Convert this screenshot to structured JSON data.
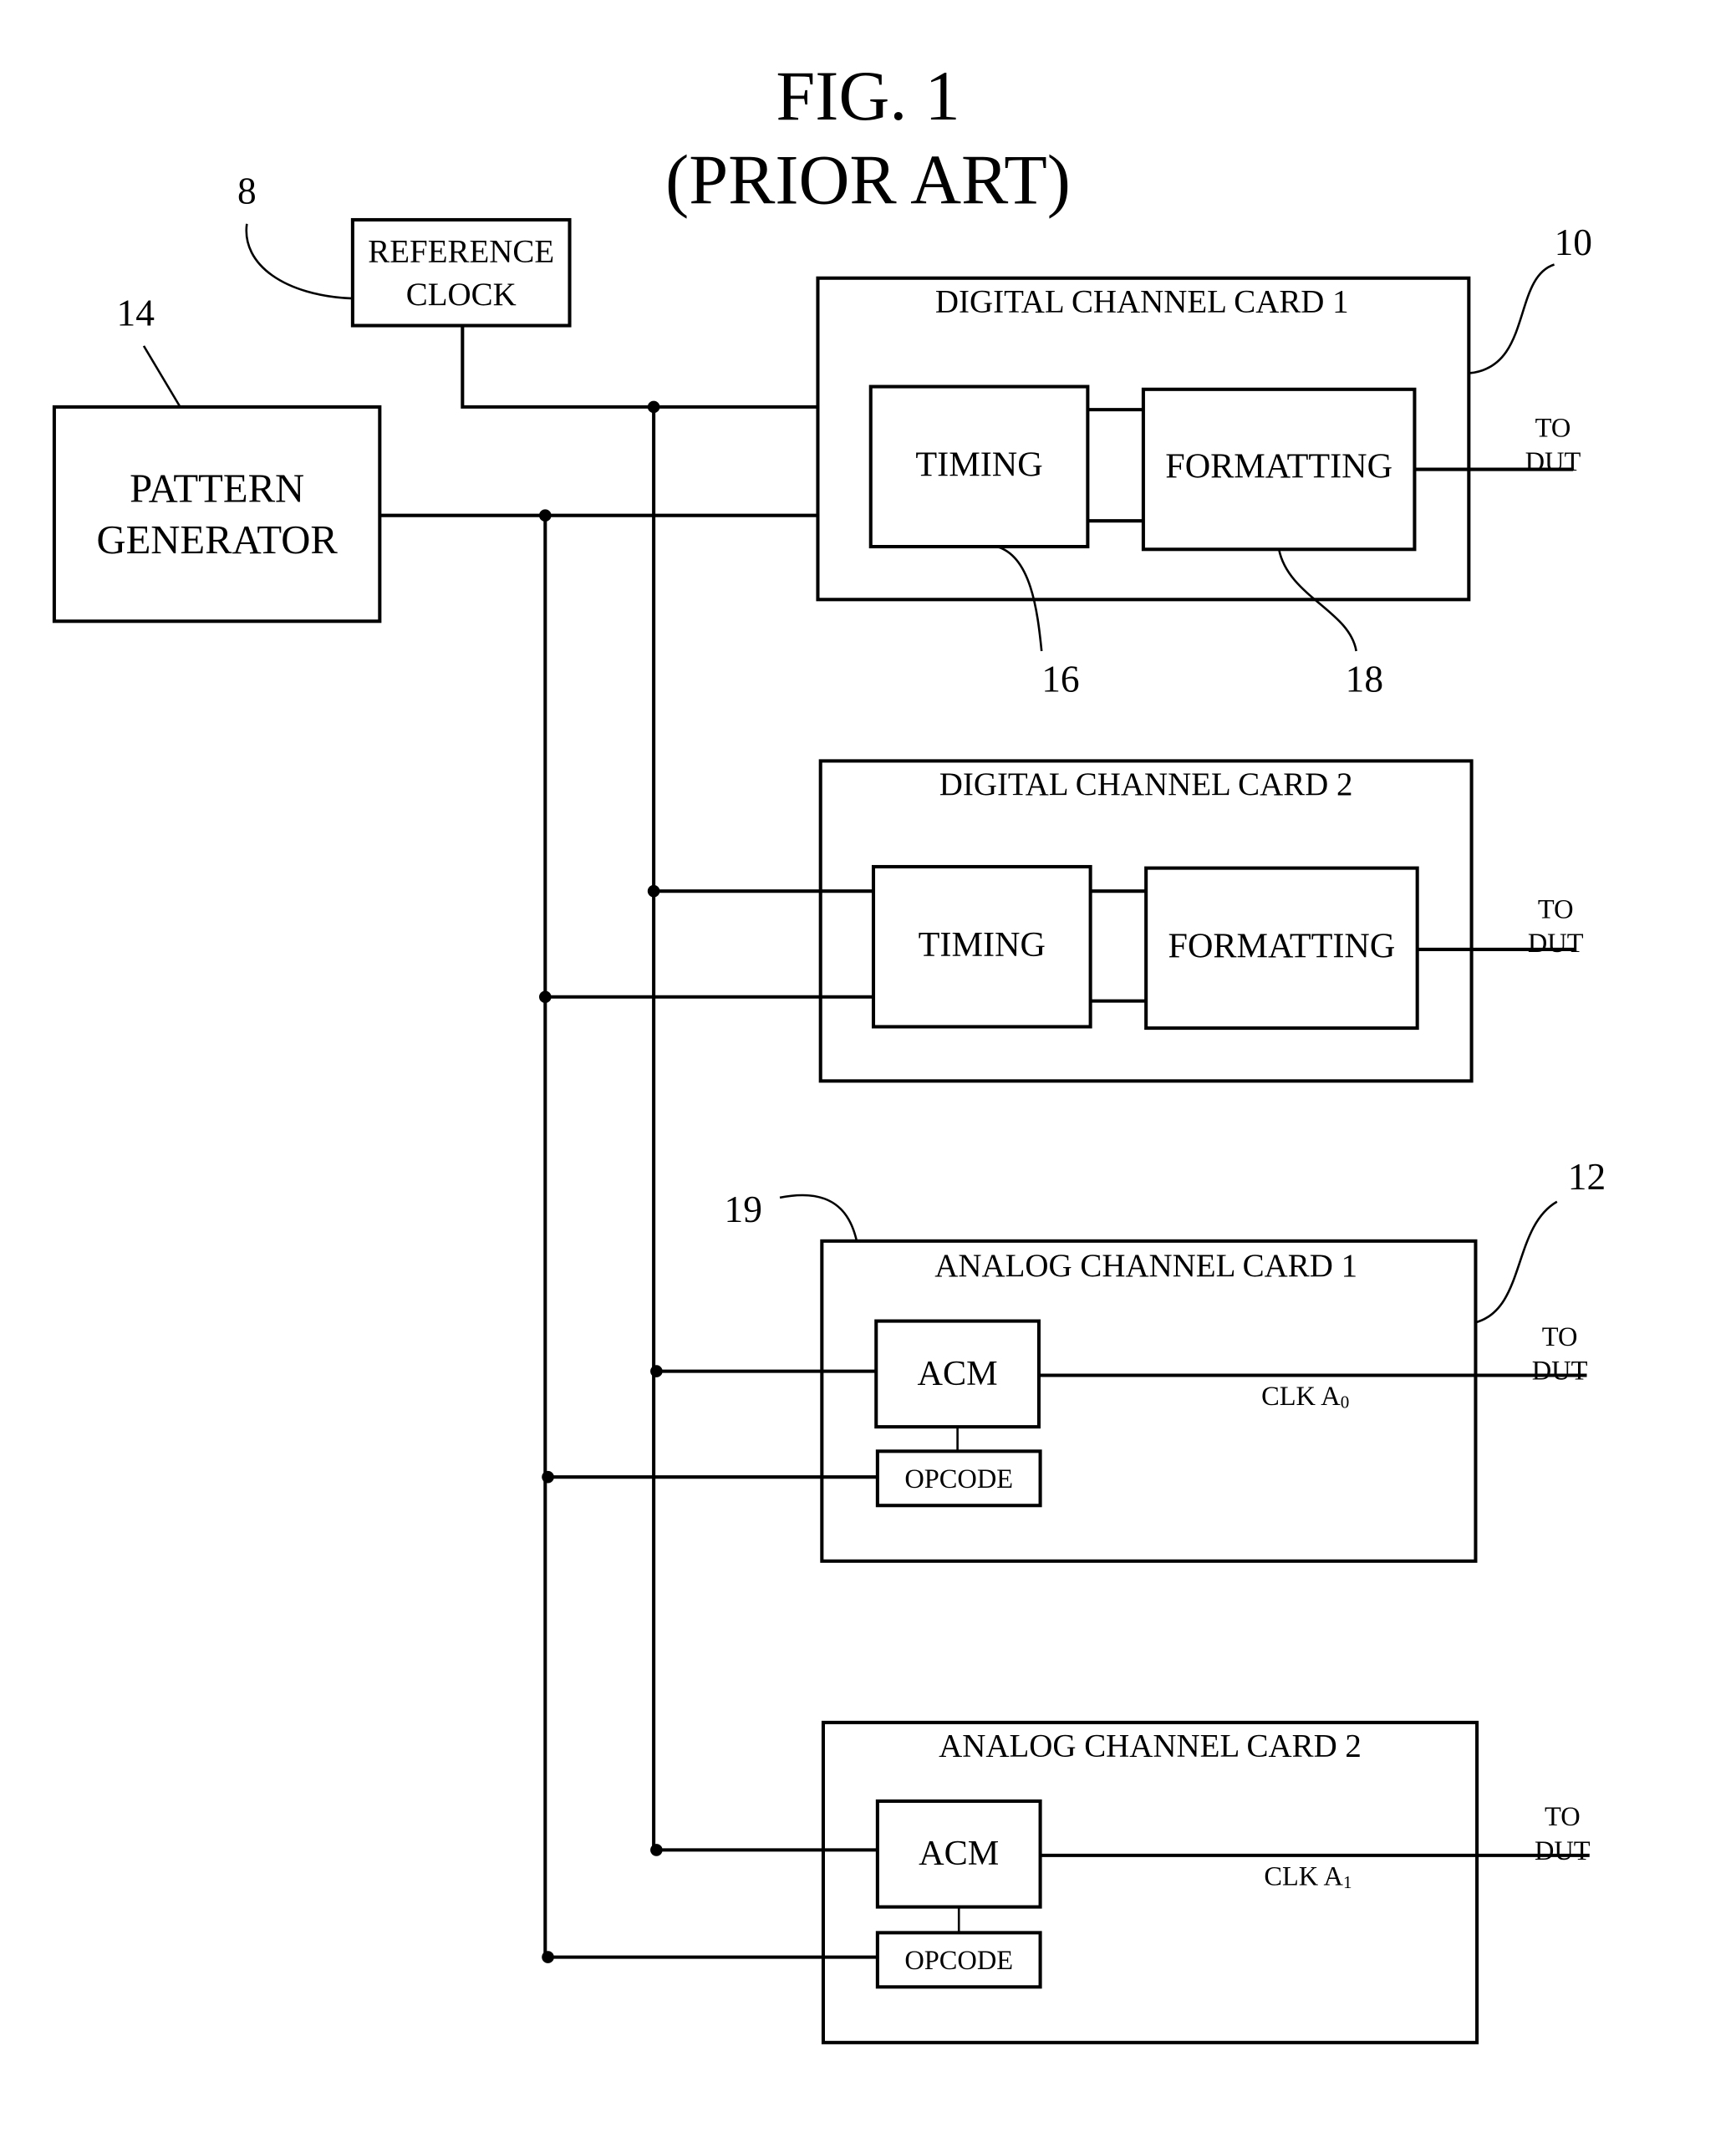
{
  "figure": {
    "title": "FIG. 1",
    "subtitle": "(PRIOR ART)"
  },
  "reference_numerals": {
    "reference_clock": "8",
    "digital_card": "10",
    "analog_card": "12",
    "pattern_generator": "14",
    "timing": "16",
    "formatting": "18",
    "acm": "19"
  },
  "blocks": {
    "reference_clock": [
      "REFERENCE",
      "CLOCK"
    ],
    "pattern_generator": [
      "PATTERN",
      "GENERATOR"
    ]
  },
  "digital_cards": [
    {
      "title": "DIGITAL CHANNEL CARD 1",
      "timing": "TIMING",
      "formatting": "FORMATTING",
      "output": [
        "TO",
        "DUT"
      ]
    },
    {
      "title": "DIGITAL CHANNEL CARD 2",
      "timing": "TIMING",
      "formatting": "FORMATTING",
      "output": [
        "TO",
        "DUT"
      ]
    }
  ],
  "analog_cards": [
    {
      "title": "ANALOG CHANNEL CARD 1",
      "acm": "ACM",
      "opcode": "OPCODE",
      "clock_label": "CLK A",
      "clock_sub": "0",
      "output": [
        "TO",
        "DUT"
      ]
    },
    {
      "title": "ANALOG CHANNEL CARD 2",
      "acm": "ACM",
      "opcode": "OPCODE",
      "clock_label": "CLK A",
      "clock_sub": "1",
      "output": [
        "TO",
        "DUT"
      ]
    }
  ]
}
